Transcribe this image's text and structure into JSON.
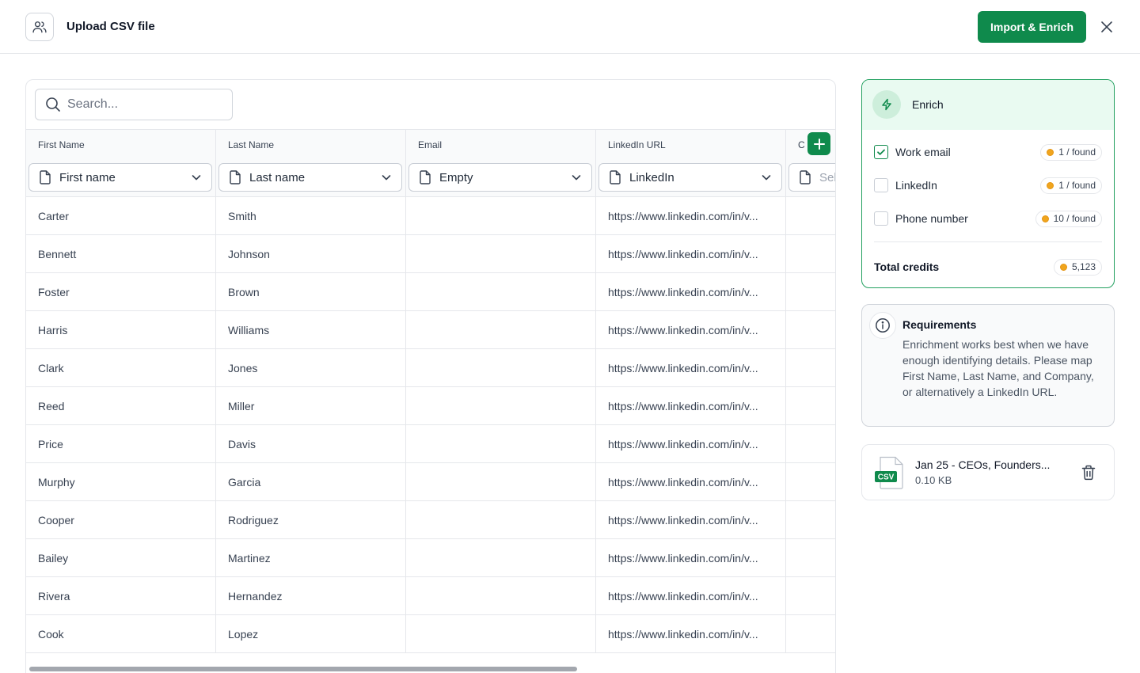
{
  "header": {
    "title": "Upload CSV file",
    "primary_button": "Import & Enrich",
    "icons": {
      "users": "users-icon",
      "close": "close-icon"
    }
  },
  "search": {
    "placeholder": "Search..."
  },
  "table": {
    "columns": [
      {
        "label": "First Name",
        "mapping": "First name"
      },
      {
        "label": "Last Name",
        "mapping": "Last name"
      },
      {
        "label": "Email",
        "mapping": "Empty"
      },
      {
        "label": "LinkedIn URL",
        "mapping": "LinkedIn"
      },
      {
        "label": "C",
        "mapping": "Sel"
      }
    ],
    "rows": [
      {
        "first": "Carter",
        "last": "Smith",
        "email": "",
        "linkedin": "https://www.linkedin.com/in/v..."
      },
      {
        "first": "Bennett",
        "last": "Johnson",
        "email": "",
        "linkedin": "https://www.linkedin.com/in/v..."
      },
      {
        "first": "Foster",
        "last": "Brown",
        "email": "",
        "linkedin": "https://www.linkedin.com/in/v..."
      },
      {
        "first": "Harris",
        "last": "Williams",
        "email": "",
        "linkedin": "https://www.linkedin.com/in/v..."
      },
      {
        "first": "Clark",
        "last": "Jones",
        "email": "",
        "linkedin": "https://www.linkedin.com/in/v..."
      },
      {
        "first": "Reed",
        "last": "Miller",
        "email": "",
        "linkedin": "https://www.linkedin.com/in/v..."
      },
      {
        "first": "Price",
        "last": "Davis",
        "email": "",
        "linkedin": "https://www.linkedin.com/in/v..."
      },
      {
        "first": "Murphy",
        "last": "Garcia",
        "email": "",
        "linkedin": "https://www.linkedin.com/in/v..."
      },
      {
        "first": "Cooper",
        "last": "Rodriguez",
        "email": "",
        "linkedin": "https://www.linkedin.com/in/v..."
      },
      {
        "first": "Bailey",
        "last": "Martinez",
        "email": "",
        "linkedin": "https://www.linkedin.com/in/v..."
      },
      {
        "first": "Rivera",
        "last": "Hernandez",
        "email": "",
        "linkedin": "https://www.linkedin.com/in/v..."
      },
      {
        "first": "Cook",
        "last": "Lopez",
        "email": "",
        "linkedin": "https://www.linkedin.com/in/v..."
      }
    ]
  },
  "enrich": {
    "title": "Enrich",
    "options": [
      {
        "label": "Work email",
        "checked": true,
        "credits": "1 / found"
      },
      {
        "label": "LinkedIn",
        "checked": false,
        "credits": "1 / found"
      },
      {
        "label": "Phone number",
        "checked": false,
        "credits": "10 / found"
      }
    ],
    "total_label": "Total credits",
    "total_value": "5,123"
  },
  "requirements": {
    "title": "Requirements",
    "text": "Enrichment works best when we have enough identifying details. Please map First Name, Last Name, and Company, or alternatively a LinkedIn URL."
  },
  "file": {
    "badge": "CSV",
    "name": "Jan 25 - CEOs, Founders...",
    "size": "0.10 KB"
  },
  "colors": {
    "accent": "#0f8a4c",
    "accent_light": "#e9faf1",
    "coin": "#f0a51e",
    "border": "#e5e7eb"
  }
}
